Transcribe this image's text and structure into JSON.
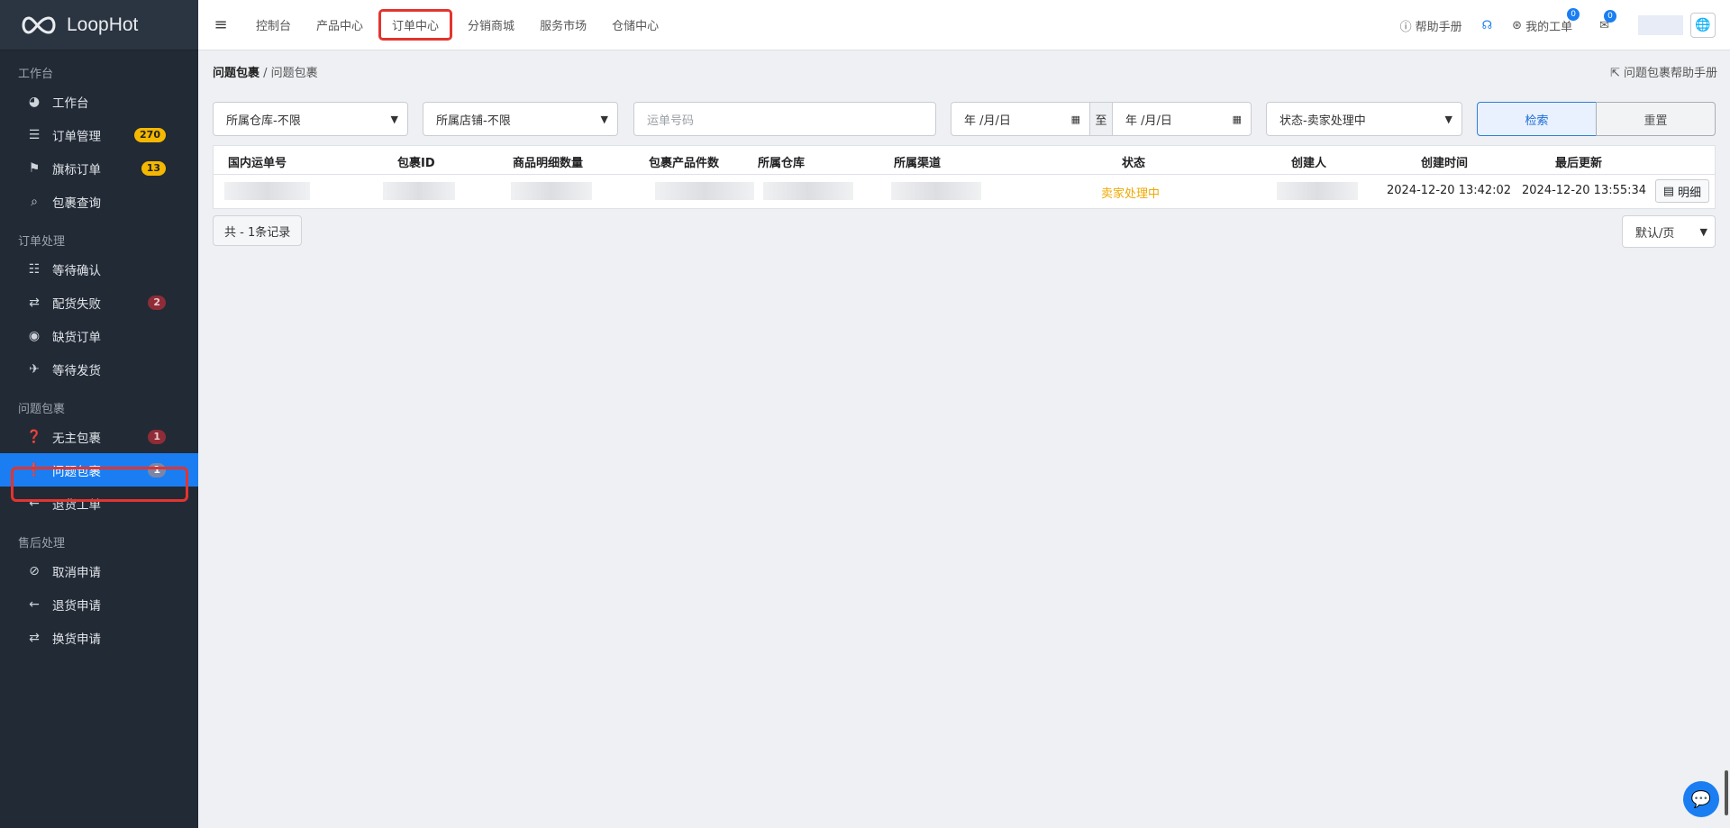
{
  "brand": {
    "name": "LoopHot"
  },
  "sidebar": {
    "sections": [
      {
        "title": "工作台",
        "items": [
          {
            "label": "工作台",
            "icon": "dashboard-icon"
          },
          {
            "label": "订单管理",
            "icon": "list-icon",
            "badge": "270"
          },
          {
            "label": "旗标订单",
            "icon": "flag-icon",
            "badge": "13"
          },
          {
            "label": "包裹查询",
            "icon": "search-icon"
          }
        ]
      },
      {
        "title": "订单处理",
        "items": [
          {
            "label": "等待确认",
            "icon": "checklist-icon"
          },
          {
            "label": "配货失败",
            "icon": "retry-icon",
            "badge": "2"
          },
          {
            "label": "缺货订单",
            "icon": "stop-icon"
          },
          {
            "label": "等待发货",
            "icon": "plane-icon"
          }
        ]
      },
      {
        "title": "问题包裹",
        "items": [
          {
            "label": "无主包裹",
            "icon": "question-icon",
            "badge": "1"
          },
          {
            "label": "问题包裹",
            "icon": "exclamation-icon",
            "badge": "1"
          },
          {
            "label": "退货工单",
            "icon": "arrow-left-icon"
          }
        ]
      },
      {
        "title": "售后处理",
        "items": [
          {
            "label": "取消申请",
            "icon": "ban-icon"
          },
          {
            "label": "退货申请",
            "icon": "arrow-left-icon"
          },
          {
            "label": "换货申请",
            "icon": "exchange-icon"
          }
        ]
      }
    ]
  },
  "topbar": {
    "links": [
      "控制台",
      "产品中心",
      "订单中心",
      "分销商城",
      "服务市场",
      "仓储中心"
    ],
    "help": "帮助手册",
    "tickets": "我的工单",
    "tickets_count": "0",
    "mail_count": "0"
  },
  "breadcrumb": {
    "parent": "问题包裹",
    "current": "问题包裹"
  },
  "help_link": "问题包裹帮助手册",
  "filters": {
    "warehouse": "所属仓库-不限",
    "store": "所属店铺-不限",
    "tracking_placeholder": "运单号码",
    "date_from": "年 /月/日",
    "date_sep": "至",
    "date_to": "年 /月/日",
    "status": "状态-卖家处理中",
    "search_label": "检索",
    "reset_label": "重置"
  },
  "table": {
    "headers": [
      "国内运单号",
      "包裹ID",
      "商品明细数量",
      "包裹产品件数",
      "所属仓库",
      "所属渠道",
      "状态",
      "创建人",
      "创建时间",
      "最后更新"
    ],
    "rows": [
      {
        "status": "卖家处理中",
        "created": "2024-12-20 13:42:02",
        "updated": "2024-12-20 13:55:34",
        "action": "明细"
      }
    ]
  },
  "footer": {
    "total": "共 - 1条记录",
    "page_size": "默认/页"
  },
  "colors": {
    "accent": "#1a7ef2",
    "sidebar_bg": "#222a36",
    "status_warning": "#f0a800",
    "highlight": "#e3342f"
  }
}
